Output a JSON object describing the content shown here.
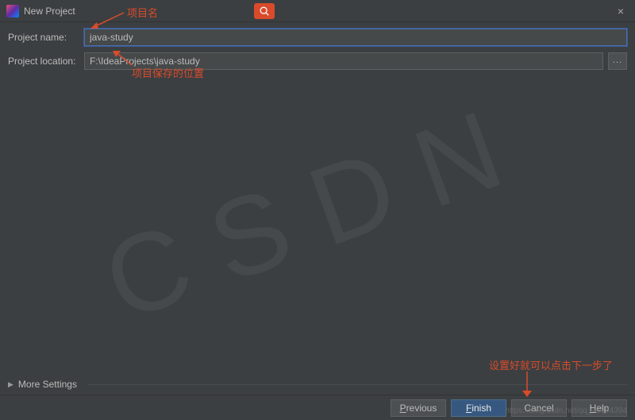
{
  "titlebar": {
    "title": "New Project",
    "close": "×"
  },
  "form": {
    "name_label": "Project name:",
    "name_value": "java-study",
    "location_label": "Project location:",
    "location_value": "F:\\IdeaProjects\\java-study",
    "browse_label": "..."
  },
  "more_settings": {
    "label": "More Settings",
    "arrow": "▶"
  },
  "footer": {
    "previous": "Previous",
    "finish": "Finish",
    "cancel": "Cancel",
    "help": "Help"
  },
  "annotations": {
    "name_hint": "项目名",
    "location_hint": "项目保存的位置",
    "finish_hint": "设置好就可以点击下一步了"
  },
  "watermark": "https://blog.csdn.net/qq_46394394"
}
